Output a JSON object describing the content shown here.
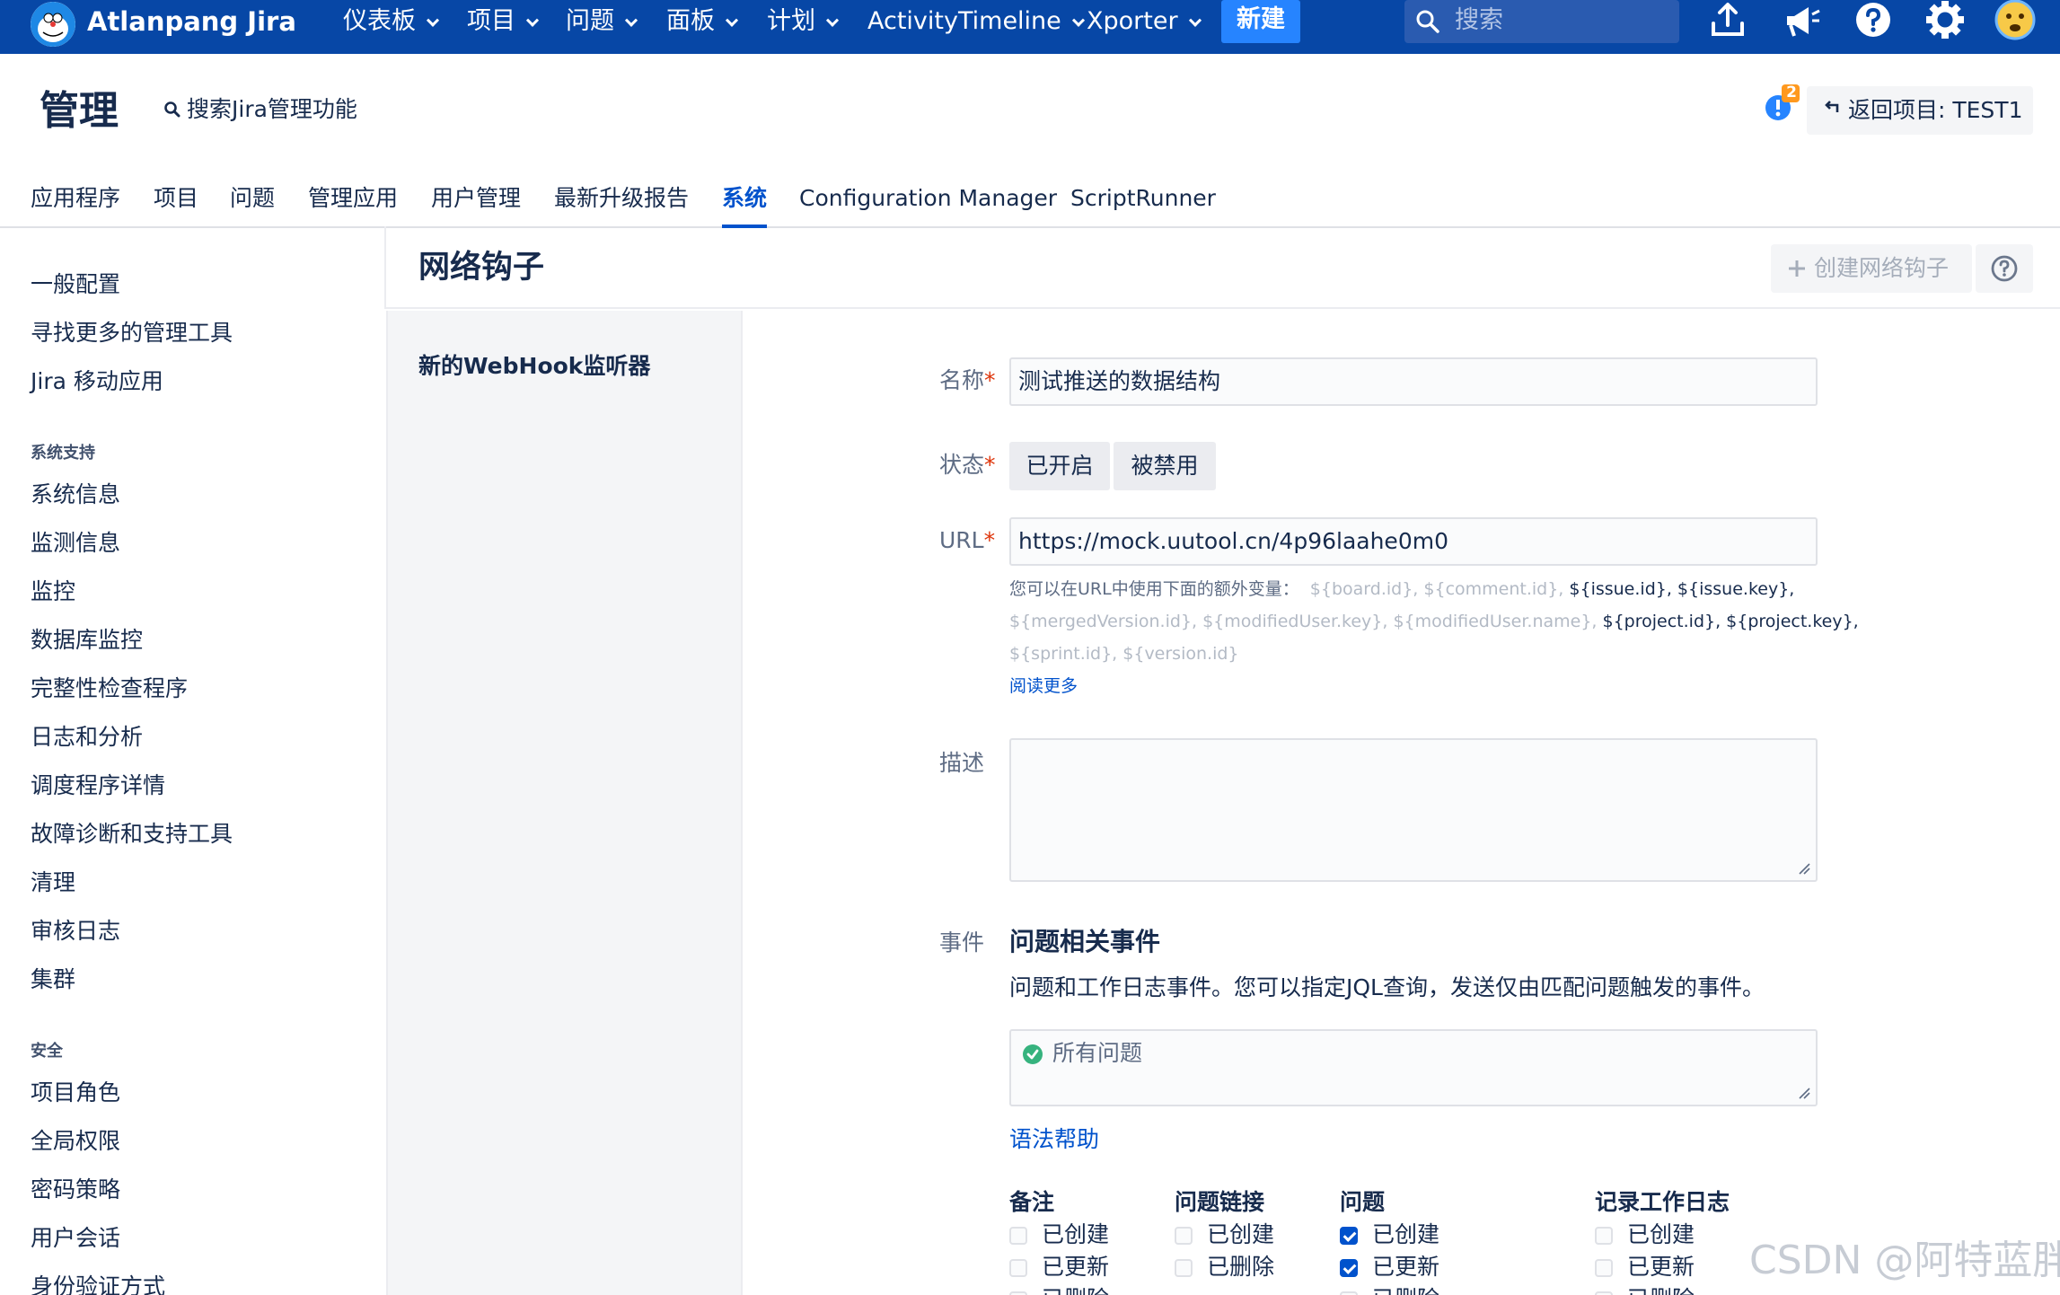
{
  "topnav": {
    "brand": "Atlanpang Jira",
    "items": [
      {
        "label": "仪表板"
      },
      {
        "label": "项目"
      },
      {
        "label": "问题"
      },
      {
        "label": "面板"
      },
      {
        "label": "计划"
      },
      {
        "label": "ActivityTimeline"
      },
      {
        "label": "Xporter"
      }
    ],
    "create_label": "新建",
    "search_placeholder": "搜索",
    "colors": {
      "bar": "#0747a6",
      "create": "#2684ff"
    }
  },
  "admin": {
    "title": "管理",
    "search_label": "搜索Jira管理功能",
    "notification_count": "2",
    "back_label": "返回项目: TEST1"
  },
  "tabs": [
    {
      "label": "应用程序"
    },
    {
      "label": "项目"
    },
    {
      "label": "问题"
    },
    {
      "label": "管理应用"
    },
    {
      "label": "用户管理"
    },
    {
      "label": "最新升级报告"
    },
    {
      "label": "系统",
      "active": true
    },
    {
      "label": "Configuration Manager"
    },
    {
      "label": "ScriptRunner"
    }
  ],
  "sidebar": {
    "top_items": [
      {
        "label": "一般配置"
      },
      {
        "label": "寻找更多的管理工具"
      },
      {
        "label": "Jira 移动应用"
      }
    ],
    "support_heading": "系统支持",
    "support_items": [
      {
        "label": "系统信息"
      },
      {
        "label": "监测信息"
      },
      {
        "label": "监控"
      },
      {
        "label": "数据库监控"
      },
      {
        "label": "完整性检查程序"
      },
      {
        "label": "日志和分析"
      },
      {
        "label": "调度程序详情"
      },
      {
        "label": "故障诊断和支持工具"
      },
      {
        "label": "清理"
      },
      {
        "label": "审核日志"
      },
      {
        "label": "集群"
      }
    ],
    "security_heading": "安全",
    "security_items": [
      {
        "label": "项目角色"
      },
      {
        "label": "全局权限"
      },
      {
        "label": "密码策略"
      },
      {
        "label": "用户会话"
      },
      {
        "label": "身份验证方式"
      }
    ]
  },
  "page": {
    "title": "网络钩子",
    "create_button": "创建网络钩子",
    "subnav_label": "新的WebHook监听器"
  },
  "form": {
    "name_label": "名称",
    "name_value": "测试推送的数据结构",
    "status_label": "状态",
    "status_enabled": "已开启",
    "status_disabled": "被禁用",
    "url_label": "URL",
    "url_value": "https://mock.uutool.cn/4p96laahe0m0",
    "url_hint_intro": "您可以在URL中使用下面的额外变量：",
    "url_hint_vars_1_faint": "${board.id}, ${comment.id},",
    "url_hint_vars_1_dark": "${issue.id}, ${issue.key},",
    "url_hint_vars_2_faint": "${mergedVersion.id}, ${modifiedUser.key}, ${modifiedUser.name},",
    "url_hint_vars_2_dark": "${project.id}, ${project.key},",
    "url_hint_vars_3_faint": "${sprint.id}, ${version.id}",
    "read_more": "阅读更多",
    "description_label": "描述",
    "events_label": "事件",
    "issue_events_title": "问题相关事件",
    "issue_events_desc": "问题和工作日志事件。您可以指定JQL查询，发送仅由匹配问题触发的事件。",
    "jql_value": "所有问题",
    "syntax_help": "语法帮助",
    "columns": [
      {
        "heading": "备注",
        "items": [
          {
            "label": "已创建",
            "checked": false
          },
          {
            "label": "已更新",
            "checked": false
          },
          {
            "label": "已删除",
            "checked": false
          }
        ]
      },
      {
        "heading": "问题链接",
        "items": [
          {
            "label": "已创建",
            "checked": false
          },
          {
            "label": "已删除",
            "checked": false
          }
        ]
      },
      {
        "heading": "问题",
        "items": [
          {
            "label": "已创建",
            "checked": true
          },
          {
            "label": "已更新",
            "checked": true
          },
          {
            "label": "已删除",
            "checked": false
          }
        ]
      },
      {
        "heading": "记录工作日志",
        "items": [
          {
            "label": "已创建",
            "checked": false
          },
          {
            "label": "已更新",
            "checked": false
          },
          {
            "label": "已删除",
            "checked": false
          }
        ]
      }
    ]
  },
  "watermark": "CSDN @阿特蓝胖"
}
